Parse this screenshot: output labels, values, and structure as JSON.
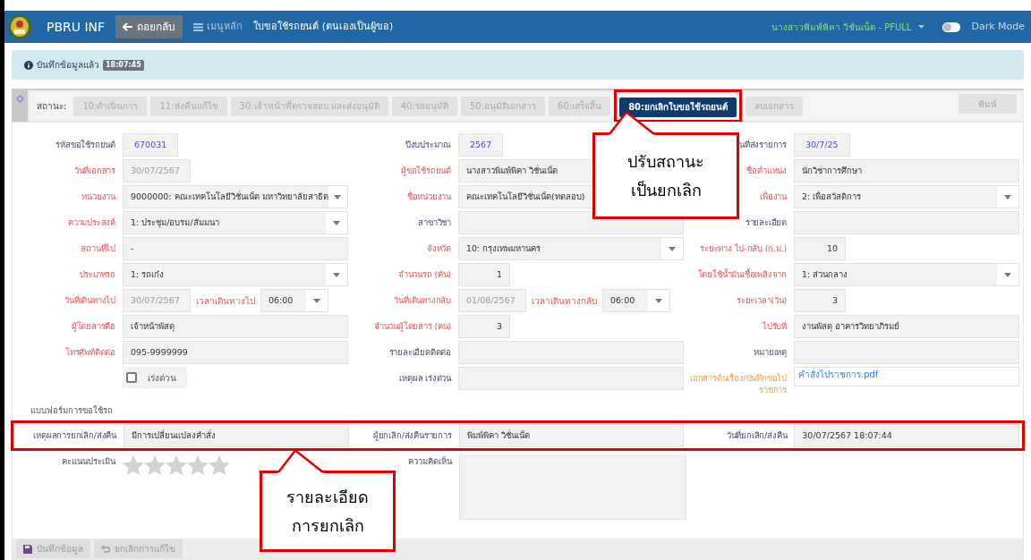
{
  "header": {
    "app_name": "PBRU INF",
    "back_button": "ถอยกลับ",
    "menu_link": "เมนูหลัก",
    "page_title": "ใบขอใช้รถยนต์ (ตนเองเป็นผู้ขอ)",
    "user": "นางสาวพิมพ์พิคา วิชั่นเน็ต - PFULL",
    "dark_mode": {
      "label": "Dark Mode",
      "on": false
    }
  },
  "alert": {
    "message": "บันทึกข้อมูลแล้ว",
    "time": "18:07:45"
  },
  "status_bar": {
    "label": "สถานะ:",
    "tabs": [
      {
        "label": "10:ดำเนินการ",
        "selected": false
      },
      {
        "label": "11:ส่งคืนแก้ไข",
        "selected": false
      },
      {
        "label": "30:เจ้าหน้าที่ตรวจสอบ และส่งอนุมัติ",
        "selected": false
      },
      {
        "label": "40:รออนุมัติ",
        "selected": false
      },
      {
        "label": "50:อนุมัติเอกสาร",
        "selected": false
      },
      {
        "label": "60:เสร็จสิ้น",
        "selected": false
      },
      {
        "label": "80:ยกเลิกใบขอใช้รถยนต์",
        "selected": true
      }
    ],
    "delete_button": "ลบเอกสาร",
    "print_button": "พิมพ์"
  },
  "form": {
    "rows": [
      [
        {
          "label": "รหัสขอใช้รถยนต์",
          "required": false,
          "kind": "id",
          "value": "670031"
        },
        {
          "label": "ปีงบประมาณ",
          "required": false,
          "kind": "id",
          "value": "2567"
        },
        {
          "label": "นที่ส่งรายการ",
          "required": false,
          "kind": "id",
          "value": "30/7/25"
        }
      ],
      [
        {
          "label": "วันที่เอกสาร",
          "required": true,
          "kind": "date",
          "value": "30/07/2567",
          "disabled": true
        },
        {
          "label": "ผู้ขอใช้รถยนต์",
          "required": true,
          "kind": "text",
          "value": "นางสาวพิมพ์พิคา วิชั่นเน็ต"
        },
        {
          "label": "ชื่อตำแหน่ง",
          "required": true,
          "kind": "text",
          "value": "นักวิชาการศึกษา"
        }
      ],
      [
        {
          "label": "หน่วยงาน",
          "required": true,
          "kind": "select",
          "value": "9000000: คณะเทคโนโลยีวิชั่นเน็ต มหาวิทยาลัยสาธิต"
        },
        {
          "label": "ชื่อหน่วยงาน",
          "required": true,
          "kind": "text",
          "value": "คณะเทคโนโลยีวิชั่นเน็ต(ทดลอบ)"
        },
        {
          "label": "เพื่องาน",
          "required": true,
          "kind": "select",
          "value": "2: เพื่อสวัสดิการ"
        }
      ],
      [
        {
          "label": "ความประสงค์",
          "required": true,
          "kind": "select",
          "value": "1: ประชุม/อบรม/สัมมนา"
        },
        {
          "label": "สาขาวิชา",
          "required": false,
          "kind": "text"
        },
        {
          "label": "รายละเอียด",
          "required": false,
          "kind": "text"
        }
      ],
      [
        {
          "label": "สถานที่ไป",
          "required": true,
          "kind": "text",
          "value": "-"
        },
        {
          "label": "จังหวัด",
          "required": true,
          "kind": "select",
          "value": "10: กรุงเทพมหานคร"
        },
        {
          "label": "ระยะทาง ไป-กลับ (ก.ม.)",
          "required": true,
          "kind": "number",
          "value": "10"
        }
      ],
      [
        {
          "label": "ประเภทรถ",
          "required": true,
          "kind": "select",
          "value": "1: รถเก๋ง"
        },
        {
          "label": "จำนวนรถ (คัน)",
          "required": true,
          "kind": "number",
          "value": "1"
        },
        {
          "label": "โดยใช้น้ำมันเชื้อเพลิงจาก",
          "required": true,
          "kind": "select",
          "value": "1: ส่วนกลาง"
        }
      ],
      [
        {
          "label": "วันที่เดินทางไป",
          "required": true,
          "kind": "datetime",
          "value": "30/07/2567",
          "disabled": true,
          "time_label": "เวลาเดินทางไป",
          "time": "06:00"
        },
        {
          "label": "วันที่เดินทางกลับ",
          "required": true,
          "kind": "datetime",
          "value": "01/08/2567",
          "disabled": true,
          "time_label": "เวลาเดินทางกลับ",
          "time": "06:00"
        },
        {
          "label": "ระยะเวลา(วัน)",
          "required": true,
          "kind": "number",
          "value": "3"
        }
      ],
      [
        {
          "label": "ผู้โดยสารคือ",
          "required": true,
          "kind": "text",
          "value": "เจ้าหน้าพัสดุ"
        },
        {
          "label": "จำนวนผู้โดยสาร (คน)",
          "required": true,
          "kind": "number",
          "value": "3"
        },
        {
          "label": "ไปรับที่",
          "required": true,
          "kind": "text",
          "value": "งานพัสดุ อาคารวิทยาภิรมย์"
        }
      ],
      [
        {
          "label": "โทรศัพท์ติดต่อ",
          "required": true,
          "kind": "text",
          "value": "095-9999999"
        },
        {
          "label": "รายละเอียดติดต่อ",
          "required": false,
          "kind": "text"
        },
        {
          "label": "หมายเหตุ",
          "required": false,
          "kind": "text"
        }
      ],
      [
        {
          "kind": "checkbox",
          "text": "เร่งด่วน",
          "checked": false
        },
        {
          "label": "เหตุผล เร่งด่วน",
          "required": false,
          "kind": "text"
        },
        {
          "label": "เอกสารต้นเรื่อง/บันทึกขอไปราชการ",
          "required": false,
          "kind": "file",
          "value": "คำสั่งไปราชการ.pdf"
        }
      ]
    ],
    "section_title": "แบบฟอร์มการขอใช้รถ",
    "cancellation": [
      {
        "label": "เหตุผลการยกเลิก/ส่งคืน",
        "value": "มีการเปลี่ยนแปลงคำสั่ง"
      },
      {
        "label": "ผู้ยกเลิก/ส่งคืนรายการ",
        "value": "พิมพ์พิคา วิชั่นเน็ต"
      },
      {
        "label": "วันที่ยกเลิก/ส่งคืน",
        "value": "30/07/2567 18:07:44"
      }
    ],
    "rating": {
      "label": "คะแนนประเมิน",
      "stars": 0
    },
    "comment": {
      "label": "ความคิดเห็น"
    }
  },
  "footer": {
    "buttons": [
      {
        "label": "บันทึกข้อมูล",
        "kind": "save"
      },
      {
        "label": "ยกเลิกการแก้ไข",
        "kind": "undo"
      }
    ]
  },
  "annotations": [
    {
      "lines": [
        "ปรับสถานะ",
        "เป็นยกเลิก"
      ]
    },
    {
      "lines": [
        "รายละเอียด",
        "การยกเลิก"
      ]
    }
  ]
}
